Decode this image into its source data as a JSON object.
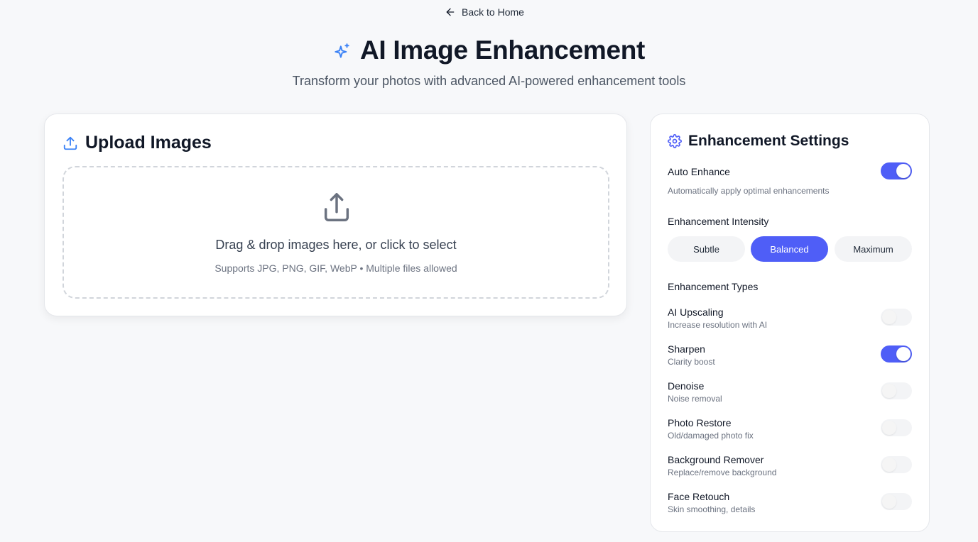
{
  "nav": {
    "back_label": "Back to Home"
  },
  "hero": {
    "title": "AI Image Enhancement",
    "subtitle": "Transform your photos with advanced AI-powered enhancement tools"
  },
  "upload": {
    "title": "Upload Images",
    "dropzone_title": "Drag & drop images here, or click to select",
    "dropzone_hint": "Supports JPG, PNG, GIF, WebP • Multiple files allowed"
  },
  "settings": {
    "title": "Enhancement Settings",
    "auto_enhance": {
      "label": "Auto Enhance",
      "description": "Automatically apply optimal enhancements",
      "enabled": true
    },
    "intensity": {
      "label": "Enhancement Intensity",
      "options": [
        "Subtle",
        "Balanced",
        "Maximum"
      ],
      "selected": "Balanced"
    },
    "types_label": "Enhancement Types",
    "types": [
      {
        "label": "AI Upscaling",
        "description": "Increase resolution with AI",
        "enabled": false
      },
      {
        "label": "Sharpen",
        "description": "Clarity boost",
        "enabled": true
      },
      {
        "label": "Denoise",
        "description": "Noise removal",
        "enabled": false
      },
      {
        "label": "Photo Restore",
        "description": "Old/damaged photo fix",
        "enabled": false
      },
      {
        "label": "Background Remover",
        "description": "Replace/remove background",
        "enabled": false
      },
      {
        "label": "Face Retouch",
        "description": "Skin smoothing, details",
        "enabled": false
      }
    ]
  },
  "colors": {
    "accent": "#4f5ef7",
    "icon_blue": "#3b82f6",
    "background": "#f7f8fa"
  },
  "icons": {
    "back": "arrow-left-icon",
    "hero": "sparkles-icon",
    "upload_header": "upload-icon",
    "dropzone": "upload-icon",
    "settings": "gear-icon"
  }
}
